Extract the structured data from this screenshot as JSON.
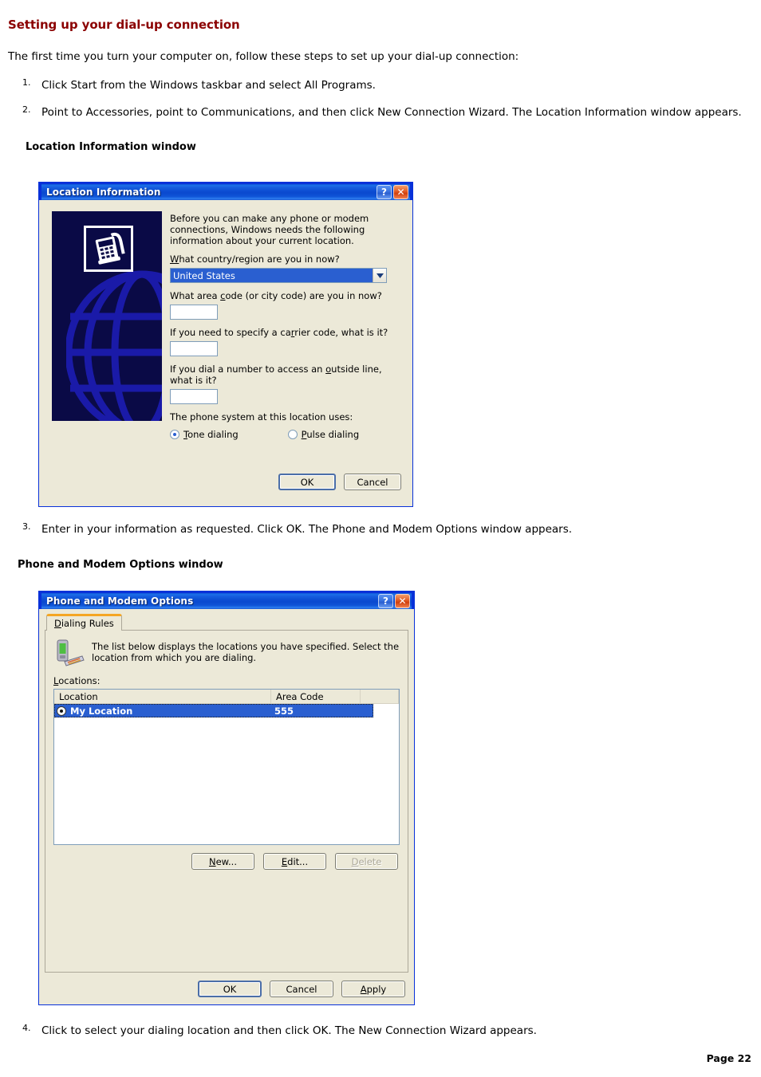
{
  "document": {
    "heading": "Setting up your dial-up connection",
    "intro": "The first time you turn your computer on, follow these steps to set up your dial-up connection:",
    "steps": [
      {
        "num": "1.",
        "text": "Click Start from the Windows taskbar and select All Programs."
      },
      {
        "num": "2.",
        "text": "Point to Accessories, point to Communications, and then click New Connection Wizard. The Location Information window appears."
      }
    ],
    "caption_location": "Location Information window",
    "step3": {
      "num": "3.",
      "text": "Enter in your information as requested. Click OK. The Phone and Modem Options window appears."
    },
    "caption_phone": "Phone and Modem Options window",
    "step4": {
      "num": "4.",
      "text": "Click to select your dialing location and then click OK. The New Connection Wizard appears."
    },
    "page_number": "Page 22",
    "heading_color": "#8B0000"
  },
  "location_dialog": {
    "title": "Location Information",
    "help_button": "?",
    "close_button": "✕",
    "intro": "Before you can make any phone or modem connections, Windows needs the following information about your current location.",
    "country_label": "What country/region are you in now?",
    "country_value": "United States",
    "area_code_label": "What area code (or city code) are you in now?",
    "area_code_value": "",
    "carrier_label": "If you need to specify a carrier code, what is it?",
    "carrier_value": "",
    "outside_line_label": "If you dial a number to access an outside line, what is it?",
    "outside_line_value": "",
    "phone_system_label": "The phone system at this location uses:",
    "tone_label": "Tone dialing",
    "pulse_label": "Pulse dialing",
    "selected_dialing": "Tone dialing",
    "ok_label": "OK",
    "cancel_label": "Cancel",
    "artwork": "globe-with-phone-image",
    "titlebar_color": "#0a49cf"
  },
  "phone_modem_dialog": {
    "title": "Phone and Modem Options",
    "help_button": "?",
    "close_button": "✕",
    "tab_label": "Dialing Rules",
    "info_text": "The list below displays the locations you have specified. Select the location from which you are dialing.",
    "locations_label": "Locations:",
    "columns": [
      "Location",
      "Area Code"
    ],
    "rows": [
      {
        "location": "My Location",
        "area_code": "555",
        "selected": true
      }
    ],
    "new_label": "New...",
    "edit_label": "Edit...",
    "delete_label": "Delete",
    "delete_disabled": true,
    "ok_label": "OK",
    "cancel_label": "Cancel",
    "apply_label": "Apply",
    "titlebar_color": "#0a49cf",
    "selection_color": "#2a5fd0",
    "tab_accent_color": "#f5a623"
  }
}
